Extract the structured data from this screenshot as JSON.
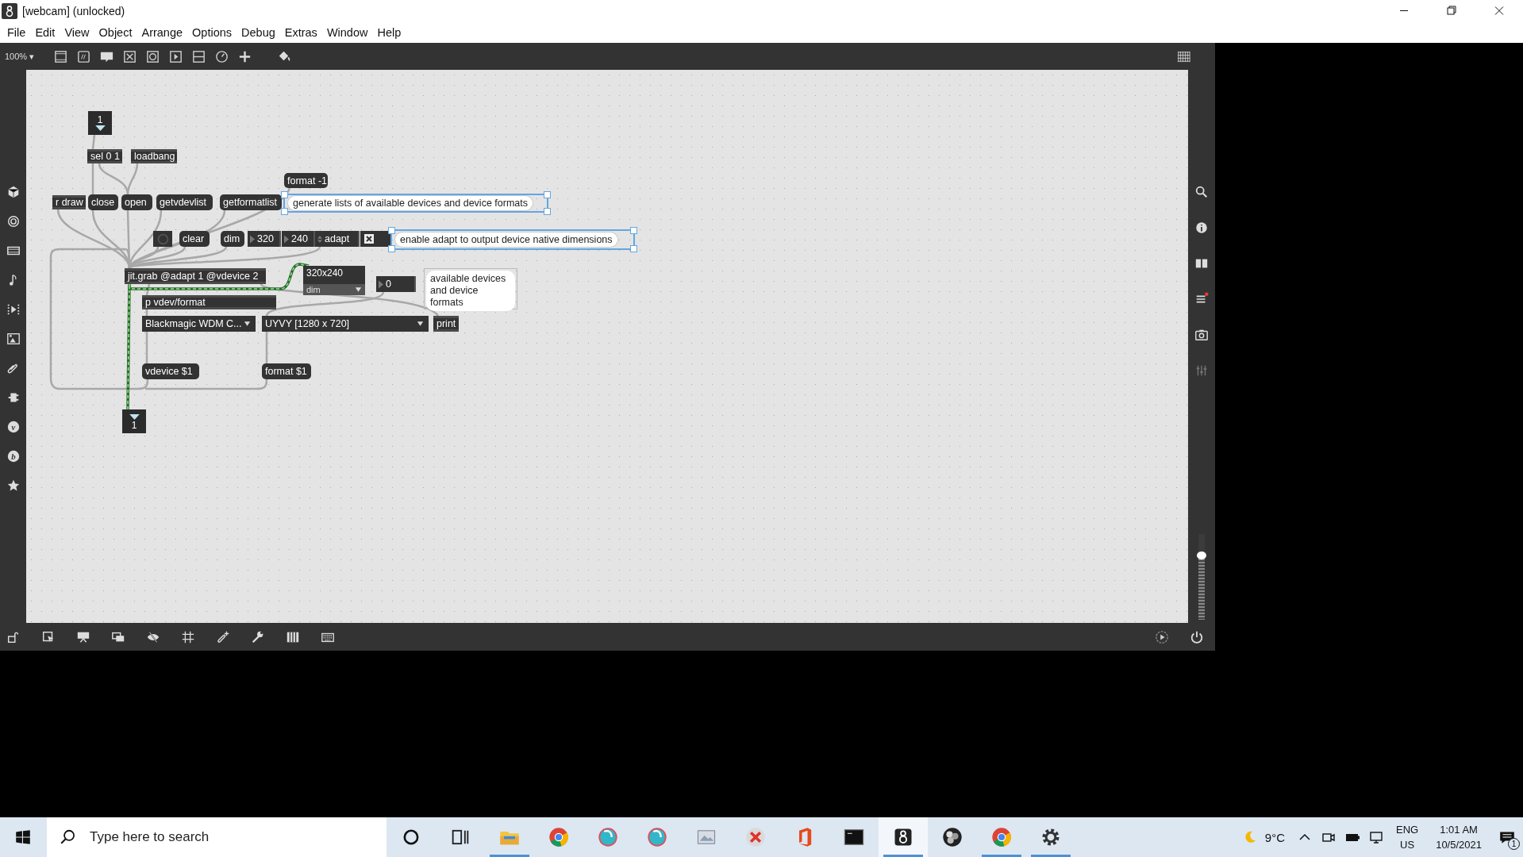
{
  "window": {
    "title": "[webcam] (unlocked)"
  },
  "menu": [
    "File",
    "Edit",
    "View",
    "Object",
    "Arrange",
    "Options",
    "Debug",
    "Extras",
    "Window",
    "Help"
  ],
  "toolbar": {
    "zoom": "100%",
    "caret": "▾",
    "tools": [
      {
        "kind": "object"
      },
      {
        "kind": "message"
      },
      {
        "kind": "comment"
      },
      {
        "kind": "toggle"
      },
      {
        "kind": "button"
      },
      {
        "kind": "play"
      },
      {
        "kind": "slider"
      },
      {
        "kind": "dial"
      },
      {
        "kind": "plus"
      },
      {
        "kind": "bucket"
      }
    ]
  },
  "left_sidebar": [
    {
      "kind": "cube"
    },
    {
      "kind": "target"
    },
    {
      "kind": "film"
    },
    {
      "kind": "note"
    },
    {
      "kind": "media"
    },
    {
      "kind": "image"
    },
    {
      "kind": "clip"
    },
    {
      "kind": "plug"
    },
    {
      "kind": "letter",
      "glyph": "v"
    },
    {
      "kind": "letter",
      "glyph": "b"
    },
    {
      "kind": "star"
    }
  ],
  "right_sidebar": {
    "tools": [
      {
        "kind": "search"
      },
      {
        "kind": "info"
      },
      {
        "kind": "book"
      },
      {
        "kind": "list",
        "alert": true
      },
      {
        "kind": "camera"
      },
      {
        "kind": "mixer"
      }
    ],
    "level": 0.75
  },
  "patch": [
    {
      "kind": "inlet",
      "text": "1"
    },
    {
      "kind": "object",
      "text": "sel 0 1"
    },
    {
      "kind": "object",
      "text": "loadbang"
    },
    {
      "kind": "message",
      "text": "format -1"
    },
    {
      "kind": "object",
      "text": "r draw"
    },
    {
      "kind": "message",
      "text": "close"
    },
    {
      "kind": "message",
      "text": "open"
    },
    {
      "kind": "message",
      "text": "getvdevlist"
    },
    {
      "kind": "message",
      "text": "getformatlist"
    },
    {
      "kind": "comment",
      "text": "generate lists of available devices and device formats",
      "selected": true
    },
    {
      "kind": "bang"
    },
    {
      "kind": "message",
      "text": "clear"
    },
    {
      "kind": "message",
      "text": "dim"
    },
    {
      "kind": "number",
      "text": "320"
    },
    {
      "kind": "number",
      "text": "240"
    },
    {
      "kind": "attrui",
      "text": "adapt"
    },
    {
      "kind": "toggle",
      "checked": true
    },
    {
      "kind": "comment",
      "text": "enable adapt to output device native dimensions",
      "selected": true
    },
    {
      "kind": "object",
      "text": "jit.grab @adapt 1 @vdevice 2"
    },
    {
      "kind": "object",
      "text": "p vdev/format"
    },
    {
      "kind": "dimgui",
      "text": "320x240",
      "label": "dim"
    },
    {
      "kind": "number",
      "text": "0"
    },
    {
      "kind": "bubble",
      "text": "available devices and device formats"
    },
    {
      "kind": "umenu",
      "text": "Blackmagic WDM C..."
    },
    {
      "kind": "umenu",
      "text": "UYVY [1280 x 720]"
    },
    {
      "kind": "object",
      "text": "print"
    },
    {
      "kind": "message",
      "text": "vdevice $1"
    },
    {
      "kind": "message",
      "text": "format $1"
    },
    {
      "kind": "outlet",
      "text": "1"
    }
  ],
  "bottom_toolbar": [
    {
      "kind": "lock"
    },
    {
      "kind": "select"
    },
    {
      "kind": "present"
    },
    {
      "kind": "windows"
    },
    {
      "kind": "eye"
    },
    {
      "kind": "grid"
    },
    {
      "kind": "clipplus"
    },
    {
      "kind": "wrench"
    },
    {
      "kind": "piano"
    },
    {
      "kind": "keyboard"
    }
  ],
  "taskbar": {
    "search": {
      "placeholder": "Type here to search"
    },
    "apps": [
      {
        "kind": "cortana",
        "running": false,
        "active": false
      },
      {
        "kind": "taskview",
        "running": false,
        "active": false
      },
      {
        "kind": "folder",
        "running": true,
        "active": false
      },
      {
        "kind": "chrome",
        "running": false,
        "active": false
      },
      {
        "kind": "orb",
        "running": false,
        "active": false
      },
      {
        "kind": "orb",
        "running": false,
        "active": false
      },
      {
        "kind": "photo",
        "running": false,
        "active": false
      },
      {
        "kind": "redx",
        "running": false,
        "active": false
      },
      {
        "kind": "office",
        "running": false,
        "active": false
      },
      {
        "kind": "terminal",
        "running": false,
        "active": false
      },
      {
        "kind": "max",
        "running": true,
        "active": true
      },
      {
        "kind": "obs",
        "running": false,
        "active": false
      },
      {
        "kind": "chrome",
        "running": true,
        "active": false
      },
      {
        "kind": "gear",
        "running": true,
        "active": false
      }
    ],
    "temperature": "9°C",
    "language": "ENG",
    "region": "US",
    "time": "1:01 AM",
    "date": "10/5/2021",
    "notifications": "1"
  }
}
